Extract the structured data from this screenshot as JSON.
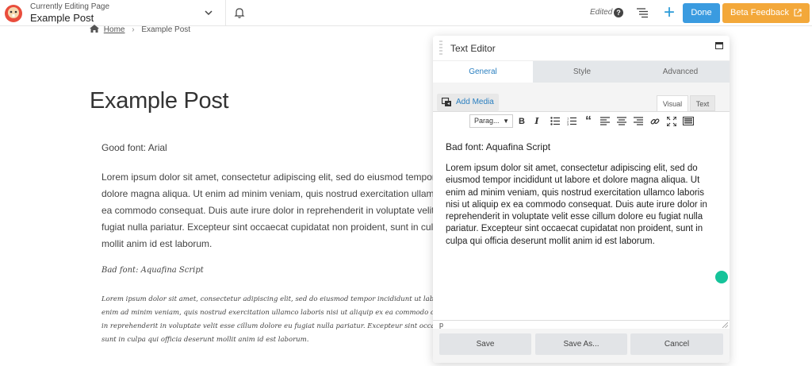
{
  "header": {
    "caption": "Currently Editing Page",
    "page_title": "Example Post",
    "status": "Edited",
    "help": "?",
    "done_label": "Done",
    "beta_label": "Beta Feedback",
    "add_symbol": "+"
  },
  "breadcrumb": {
    "home": "Home",
    "current": "Example Post"
  },
  "page": {
    "title": "Example Post",
    "good_font_label": "Good font: Arial",
    "good_lorem": "Lorem ipsum dolor sit amet, consectetur adipiscing elit, sed do eiusmod tempor incididunt ut labore et dolore magna aliqua. Ut enim ad minim veniam, quis nostrud exercitation ullamco laboris nisi ut aliquip ex ea commodo consequat. Duis aute irure dolor in reprehenderit in voluptate velit esse cillum dolore eu fugiat nulla pariatur. Excepteur sint occaecat cupidatat non proident, sunt in culpa qui officia deserunt mollit anim id est laborum.",
    "bad_font_label": "Bad font: Aquafina Script",
    "bad_lorem": "Lorem ipsum dolor sit amet, consectetur adipiscing elit, sed do eiusmod tempor incididunt ut labore et dolore magna aliqua. Ut enim ad minim veniam, quis nostrud exercitation ullamco laboris nisi ut aliquip ex ea commodo consequat. Duis aute irure dolor in reprehenderit in voluptate velit esse cillum dolore eu fugiat nulla pariatur. Excepteur sint occaecat cupidatat non proident, sunt in culpa qui officia deserunt mollit anim id est laborum."
  },
  "panel": {
    "title": "Text Editor",
    "tabs": [
      {
        "label": "General"
      },
      {
        "label": "Style"
      },
      {
        "label": "Advanced"
      }
    ],
    "add_media_label": "Add Media",
    "mode_visual": "Visual",
    "mode_text": "Text",
    "format_value": "Parag...",
    "content_heading": "Bad font: Aquafina Script",
    "content_lorem": "Lorem ipsum dolor sit amet, consectetur adipiscing elit, sed do eiusmod tempor incididunt ut labore et dolore magna aliqua. Ut enim ad minim veniam, quis nostrud exercitation ullamco laboris nisi ut aliquip ex ea commodo consequat. Duis aute irure dolor in reprehenderit in voluptate velit esse cillum dolore eu fugiat nulla pariatur. Excepteur sint occaecat cupidatat non proident, sunt in culpa qui officia deserunt mollit anim id est laborum.",
    "status_path": "p",
    "save_label": "Save",
    "save_as_label": "Save As...",
    "cancel_label": "Cancel"
  },
  "colors": {
    "accent_blue": "#3a9be0",
    "beta_orange": "#f3a83a",
    "tab_active_text": "#2a7fc0"
  }
}
